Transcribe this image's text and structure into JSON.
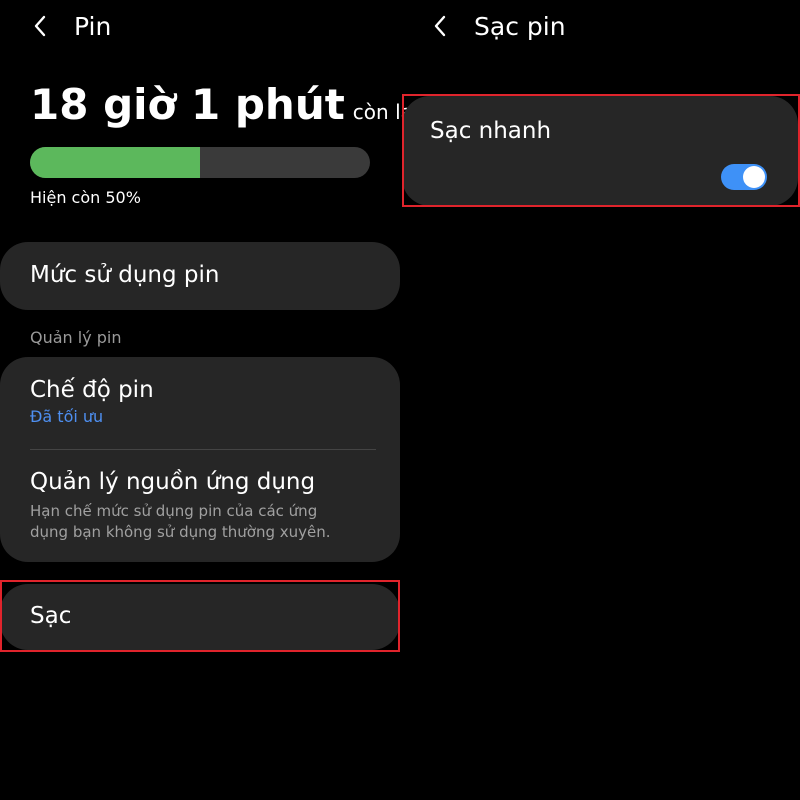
{
  "left_screen": {
    "header": {
      "back_icon": "chevron-left-icon",
      "title": "Pin"
    },
    "battery": {
      "time_remaining": "18 giờ 1 phút",
      "time_suffix": "còn lại",
      "level_fraction": 0.5,
      "percent_text": "Hiện còn 50%",
      "bar_fill_color": "#5cb85c",
      "bar_track_color": "#3a3a3a"
    },
    "usage_item": {
      "label": "Mức sử dụng pin"
    },
    "section_label": "Quản lý pin",
    "battery_mode": {
      "label": "Chế độ pin",
      "value": "Đã tối ưu"
    },
    "app_power": {
      "label": "Quản lý nguồn ứng dụng",
      "desc_line1": "Hạn chế mức sử dụng pin của các ứng",
      "desc_line2": "dụng bạn không sử dụng thường xuyên."
    },
    "charging_item": {
      "label": "Sạc"
    }
  },
  "right_screen": {
    "header": {
      "back_icon": "chevron-left-icon",
      "title": "Sạc pin"
    },
    "fast_charging": {
      "label": "Sạc nhanh",
      "enabled": true
    }
  },
  "colors": {
    "background": "#000000",
    "card": "#262626",
    "accent_blue": "#4e8ff0",
    "toggle_on": "#3e91f7",
    "highlight_red": "#e0242c"
  }
}
